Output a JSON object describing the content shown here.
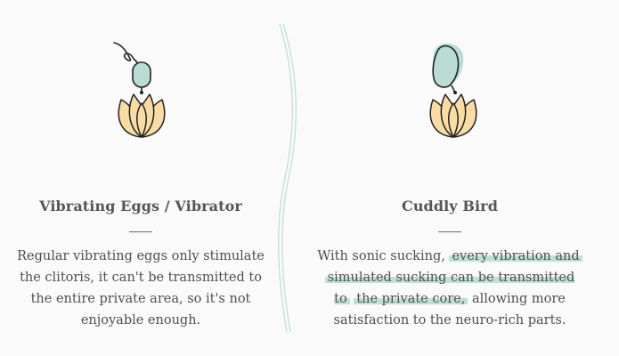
{
  "products": [
    {
      "title": "Vibrating Eggs / Vibrator",
      "description": "Regular vibrating eggs only stimulate the clitoris, it can't be transmitted to the entire private area, so it's not enjoyable enough.",
      "icon": "vibrating-egg-lotus-illustration"
    },
    {
      "title": "Cuddly Bird",
      "description_prefix": "With sonic sucking,",
      "description_highlight_1": "every vibration and",
      "description_highlight_2": "simulated sucking can be transmitted to",
      "description_highlight_3": "the private core,",
      "description_suffix": "allowing more satisfaction to the neuro-rich parts.",
      "icon": "cuddly-bird-lotus-illustration"
    }
  ],
  "colors": {
    "background": "#fafafa",
    "text": "#4f4f4f",
    "highlight": "#bfe0d6",
    "mint": "#b9ddd3",
    "petal": "#f9dca3",
    "divider": "#bfe0d8"
  }
}
